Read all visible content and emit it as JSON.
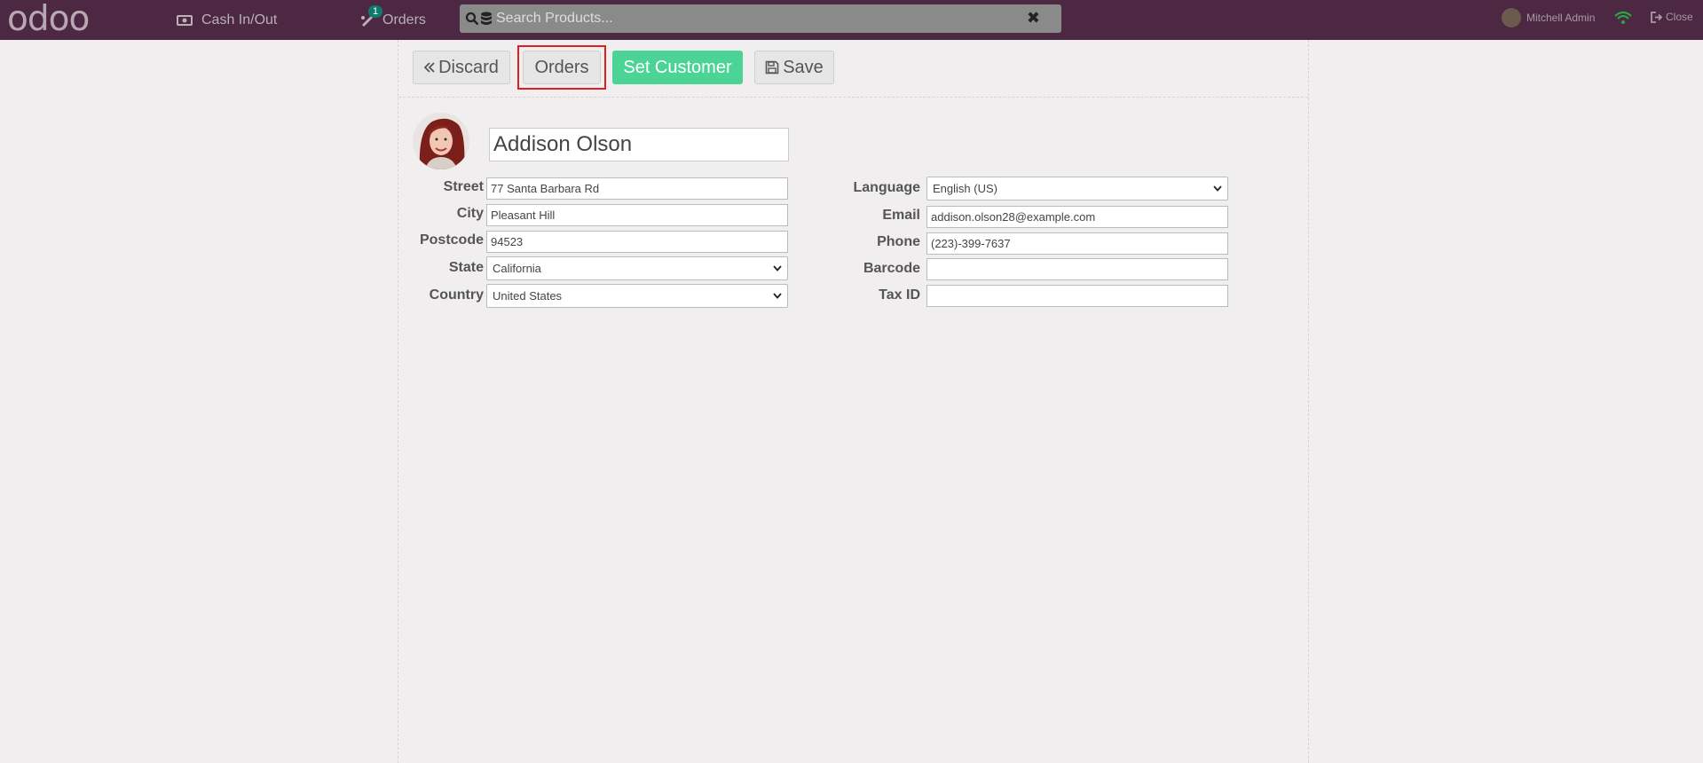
{
  "topbar": {
    "logo": "odoo",
    "cash_label": "Cash In/Out",
    "orders_label": "Orders",
    "orders_badge": "1",
    "search_placeholder": "Search Products...",
    "user_name": "Mitchell Admin",
    "close_label": "Close"
  },
  "toolbar": {
    "discard_label": "Discard",
    "orders_label": "Orders",
    "set_customer_label": "Set Customer",
    "save_label": "Save"
  },
  "customer": {
    "name": "Addison Olson",
    "left_fields": [
      {
        "label": "Street",
        "value": "77 Santa Barbara Rd"
      },
      {
        "label": "City",
        "value": "Pleasant Hill"
      },
      {
        "label": "Postcode",
        "value": "94523"
      },
      {
        "label": "State",
        "value": "California"
      },
      {
        "label": "Country",
        "value": "United States"
      }
    ],
    "right_fields": [
      {
        "label": "Language",
        "value": "English (US)"
      },
      {
        "label": "Email",
        "value": "addison.olson28@example.com"
      },
      {
        "label": "Phone",
        "value": "(223)-399-7637"
      },
      {
        "label": "Barcode",
        "value": ""
      },
      {
        "label": "Tax ID",
        "value": ""
      }
    ]
  },
  "colors": {
    "topbar": "#4c2842",
    "set_customer": "#4cd497",
    "highlight": "#e02020",
    "badge": "#0f7b6c"
  }
}
